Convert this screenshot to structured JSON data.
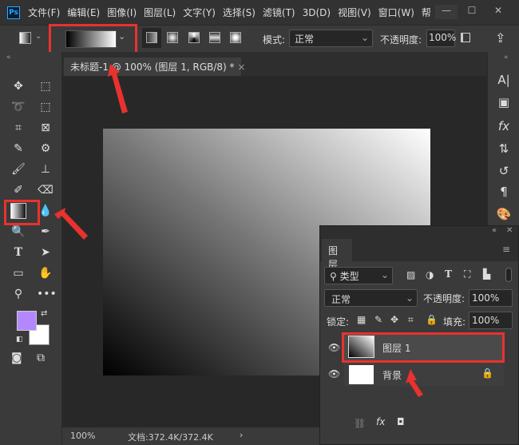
{
  "app": {
    "logo": "Ps"
  },
  "menu": [
    "文件(F)",
    "编辑(E)",
    "图像(I)",
    "图层(L)",
    "文字(Y)",
    "选择(S)",
    "滤镜(T)",
    "3D(D)",
    "视图(V)",
    "窗口(W)",
    "帮"
  ],
  "window": {
    "minimize": "—",
    "maximize": "☐",
    "close": "✕"
  },
  "options": {
    "mode_label": "模式:",
    "mode_value": "正常",
    "opacity_label": "不透明度:",
    "opacity_value": "100%",
    "gradient": "black-to-white"
  },
  "document": {
    "tab_title": "未标题-1 @ 100% (图层 1, RGB/8) *",
    "close": "×"
  },
  "colors": {
    "foreground": "#b388ff",
    "background": "#ffffff",
    "highlight": "#e8322f"
  },
  "layers_panel": {
    "title": "图层",
    "filter_label": "类型",
    "blend_mode": "正常",
    "opacity_label": "不透明度:",
    "opacity_value": "100%",
    "lock_label": "锁定:",
    "fill_label": "填充:",
    "fill_value": "100%",
    "layers": [
      {
        "name": "图层 1",
        "visible": true,
        "selected": true
      },
      {
        "name": "背景",
        "visible": true,
        "locked": true
      }
    ]
  },
  "status": {
    "zoom": "100%",
    "doc_info": "文档:372.4K/372.4K",
    "arrow": "›"
  }
}
